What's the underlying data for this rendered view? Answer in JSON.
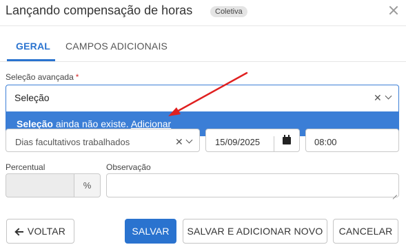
{
  "header": {
    "title": "Lançando compensação de horas",
    "badge": "Coletiva",
    "close_icon": "close-icon"
  },
  "tabs": [
    {
      "label": "GERAL",
      "active": true
    },
    {
      "label": "CAMPOS ADICIONAIS",
      "active": false
    }
  ],
  "advanced_selection": {
    "label": "Seleção avançada",
    "required_mark": "*",
    "value": "Seleção",
    "dropdown": {
      "term": "Seleção",
      "message": " ainda não existe. ",
      "action": "Adicionar"
    }
  },
  "type_field": {
    "value": "Dias facultativos trabalhados"
  },
  "date_field": {
    "value": "15/09/2025",
    "icon": "calendar-icon"
  },
  "time_field": {
    "value": "08:00"
  },
  "percentual": {
    "label": "Percentual",
    "value": "",
    "suffix": "%"
  },
  "observacao": {
    "label": "Observação",
    "value": ""
  },
  "buttons": {
    "back": "VOLTAR",
    "save": "SALVAR",
    "save_add": "SALVAR E ADICIONAR NOVO",
    "cancel": "CANCELAR"
  },
  "colors": {
    "primary": "#2a73cf",
    "dropdown_highlight": "#3b7ed6",
    "annotation_arrow": "#e02020",
    "required": "#d62d2d"
  }
}
